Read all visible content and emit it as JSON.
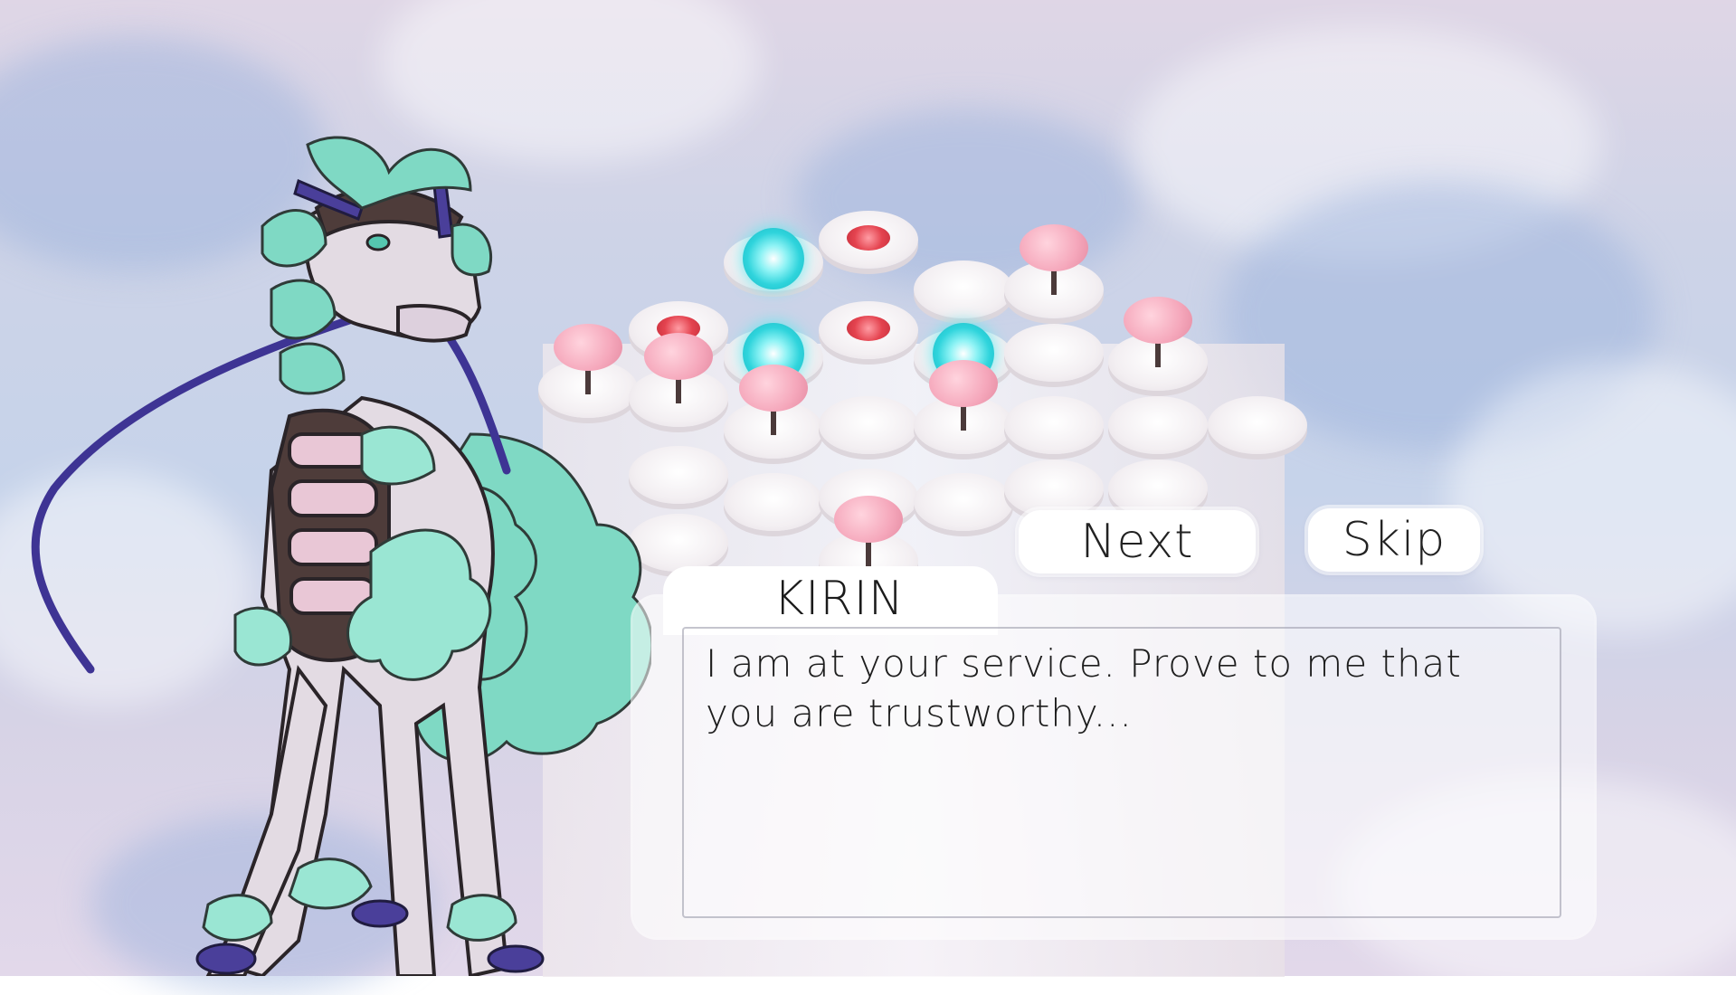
{
  "dialog": {
    "speaker": "KIRIN",
    "text": "I am at your service. Prove to me that you are trustworthy..."
  },
  "buttons": {
    "next_label": "Next",
    "skip_label": "Skip"
  },
  "colors": {
    "sky": "#cdd3e7",
    "orb": "#2fd4dc",
    "red_marker": "#e4434f",
    "blossom": "#f5a7bb",
    "kirin_mane": "#7fd9c4",
    "kirin_horn": "#4a3f9a"
  }
}
